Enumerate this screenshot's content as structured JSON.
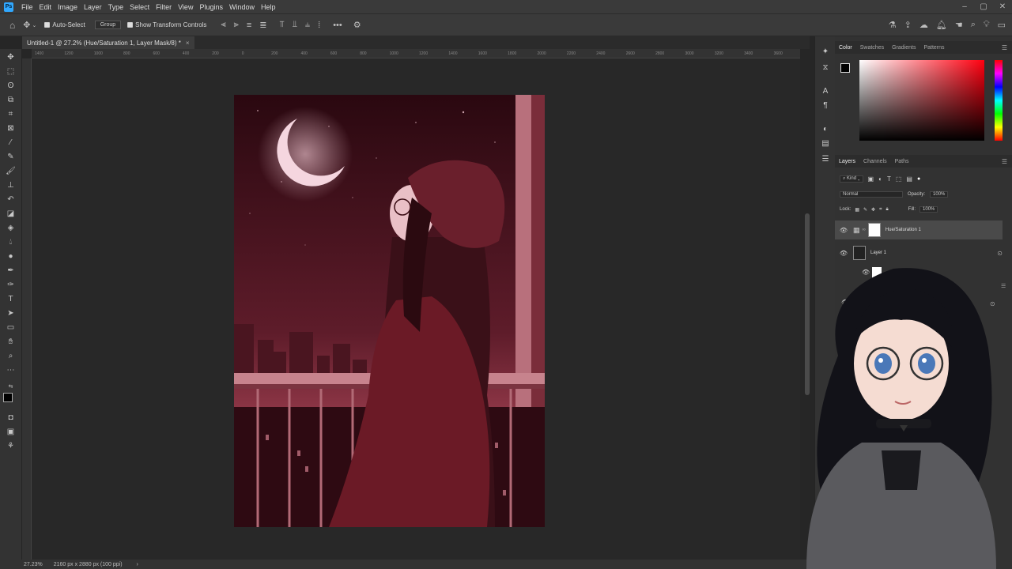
{
  "menu": [
    "File",
    "Edit",
    "Image",
    "Layer",
    "Type",
    "Select",
    "Filter",
    "View",
    "Plugins",
    "Window",
    "Help"
  ],
  "options": {
    "auto_select_label": "Auto-Select",
    "group_value": "Group",
    "show_transform_label": "Show Transform Controls"
  },
  "document_tab": {
    "title": "Untitled-1 @ 27.2% (Hue/Saturation 1, Layer Mask/8) *",
    "close": "×"
  },
  "ruler_ticks": [
    "1400",
    "1200",
    "1000",
    "800",
    "600",
    "400",
    "200",
    "0",
    "200",
    "400",
    "600",
    "800",
    "1000",
    "1200",
    "1400",
    "1600",
    "1800",
    "2000",
    "2200",
    "2400",
    "2600",
    "2800",
    "3000",
    "3200",
    "3400",
    "3600"
  ],
  "status": {
    "zoom": "27.23%",
    "doc_info": "2160 px x 2880 px (100 ppi)",
    "arrow": "›"
  },
  "color_panel": {
    "tabs": [
      "Color",
      "Swatches",
      "Gradients",
      "Patterns"
    ],
    "accent": "#ff0010"
  },
  "layers_panel": {
    "tabs": [
      "Layers",
      "Channels",
      "Paths"
    ],
    "filter_kind": "Kind",
    "blend_mode": "Normal",
    "opacity_label": "Opacity:",
    "opacity_value": "100%",
    "lock_label": "Lock:",
    "fill_label": "Fill:",
    "fill_value": "100%",
    "layers": [
      {
        "name": "Hue/Saturation 1"
      },
      {
        "name": "Layer 1"
      }
    ]
  }
}
